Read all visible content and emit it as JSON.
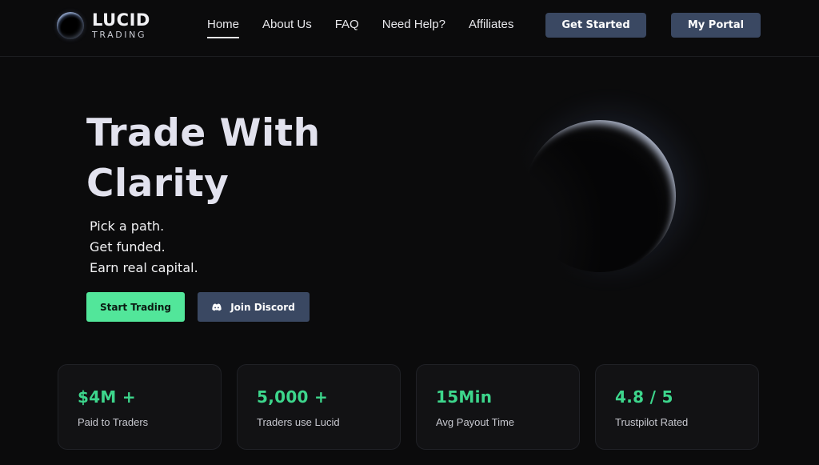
{
  "brand": {
    "name": "LUCID",
    "subtitle": "TRADING"
  },
  "nav": {
    "items": [
      {
        "label": "Home",
        "active": true
      },
      {
        "label": "About Us",
        "active": false
      },
      {
        "label": "FAQ",
        "active": false
      },
      {
        "label": "Need Help?",
        "active": false
      },
      {
        "label": "Affiliates",
        "active": false
      }
    ],
    "get_started_label": "Get Started",
    "portal_label": "My Portal"
  },
  "hero": {
    "title_line1": "Trade With",
    "title_line2": "Clarity",
    "tagline": [
      "Pick a path.",
      "Get funded.",
      "Earn real capital."
    ],
    "start_trading_label": "Start Trading",
    "discord_label": "Join Discord",
    "discord_icon": "discord-icon"
  },
  "stats": [
    {
      "value": "$4M +",
      "label": "Paid to Traders"
    },
    {
      "value": "5,000 +",
      "label": "Traders use Lucid"
    },
    {
      "value": "15Min",
      "label": "Avg Payout Time"
    },
    {
      "value": "4.8 / 5",
      "label": "Trustpilot Rated"
    }
  ],
  "colors": {
    "background": "#0b0b0c",
    "accent_green": "#52e69a",
    "stat_green": "#3dd68c",
    "button_slate": "#3a4862",
    "title_text": "#e2e2ee"
  }
}
